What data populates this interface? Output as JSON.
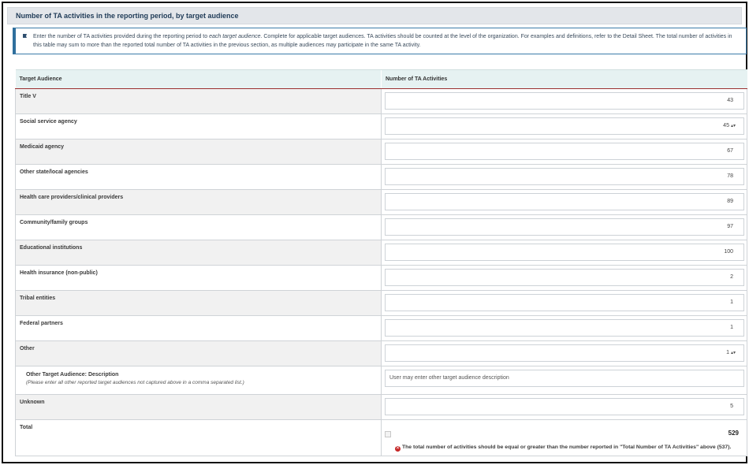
{
  "section": {
    "title": "Number of TA activities in the reporting period, by target audience",
    "info_pre": "Enter the number of TA activities provided during the reporting period to ",
    "info_em": "each target audience",
    "info_post": ". Complete for applicable target audiences. TA activities should be counted at the level of the organization. For examples and definitions, refer to the Detail Sheet. The total number of activities in this table may sum to more than the reported total number of TA activities in the previous section, as multiple audiences may participate in the same TA activity."
  },
  "table": {
    "col_audience": "Target Audience",
    "col_count": "Number of TA Activities",
    "rows": [
      {
        "label": "Title V",
        "value": "43"
      },
      {
        "label": "Social service agency",
        "value": "45"
      },
      {
        "label": "Medicaid agency",
        "value": "67"
      },
      {
        "label": "Other state/local agencies",
        "value": "78"
      },
      {
        "label": "Health care providers/clinical providers",
        "value": "89"
      },
      {
        "label": "Community/family groups",
        "value": "97"
      },
      {
        "label": "Educational institutions",
        "value": "100"
      },
      {
        "label": "Health insurance (non-public)",
        "value": "2"
      },
      {
        "label": "Tribal entities",
        "value": "1"
      },
      {
        "label": "Federal partners",
        "value": "1"
      },
      {
        "label": "Other",
        "value": "1"
      }
    ],
    "other_desc": {
      "label": "Other Target Audience: Description",
      "hint": "(Please enter all other reported target audiences not captured above in a comma separated list.)",
      "value": "User may enter other target audience description"
    },
    "unknown": {
      "label": "Unknown",
      "value": "5"
    },
    "total": {
      "label": "Total",
      "value": "529",
      "error": "The total number of activities should be equal or greater than the number reported in \"Total Number of TA Activities\" above (537)."
    }
  },
  "icons": {
    "info": "pin-icon",
    "stepper": "stepper-arrows-icon",
    "error": "error-x-icon"
  },
  "colors": {
    "header_bg": "#e3e6ea",
    "table_header_bg": "#e6f2f2",
    "info_border": "#2f6f9d",
    "error": "#c62828",
    "header_rule": "#9a3030"
  }
}
